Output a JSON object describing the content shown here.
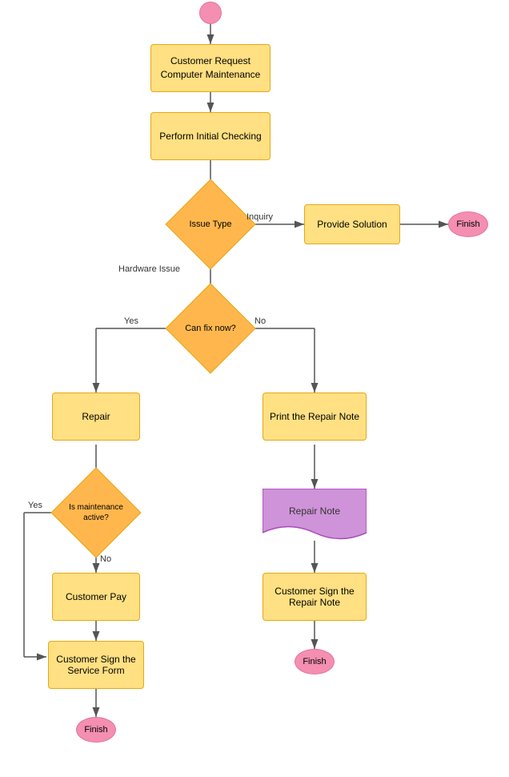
{
  "nodes": {
    "start": {
      "label": ""
    },
    "customer_request": {
      "label": "Customer Request\nComputer Maintenance"
    },
    "perform_checking": {
      "label": "Perform Initial Checking"
    },
    "issue_type": {
      "label": "Issue Type"
    },
    "provide_solution": {
      "label": "Provide Solution"
    },
    "finish_top": {
      "label": "Finish"
    },
    "can_fix": {
      "label": "Can fix now?"
    },
    "repair": {
      "label": "Repair"
    },
    "print_repair": {
      "label": "Print the Repair Note"
    },
    "is_maintenance": {
      "label": "Is\nmaintenance\nactive?"
    },
    "repair_note": {
      "label": "Repair Note"
    },
    "customer_pay": {
      "label": "Customer Pay"
    },
    "customer_sign_repair": {
      "label": "Customer Sign the Repair\nNote"
    },
    "customer_sign_service": {
      "label": "Customer Sign the Service\nForm"
    },
    "finish_right": {
      "label": "Finish"
    },
    "finish_bottom": {
      "label": "Finish"
    }
  },
  "labels": {
    "inquiry": "Inquiry",
    "hardware": "Hardware Issue",
    "yes_left": "Yes",
    "no_right": "No",
    "yes_loop": "Yes",
    "no_down": "No"
  }
}
